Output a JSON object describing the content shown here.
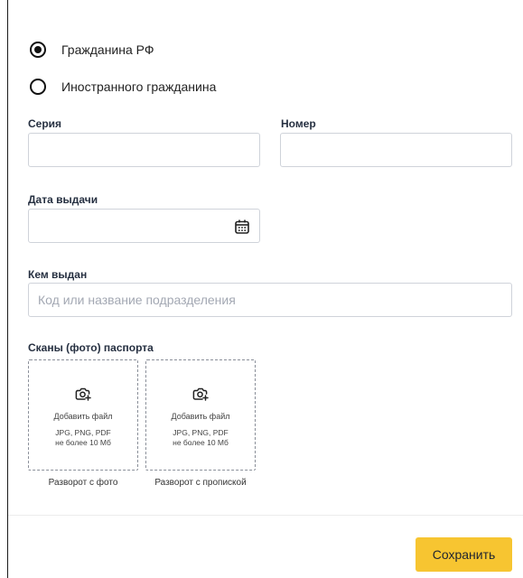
{
  "citizenship": {
    "options": [
      {
        "label": "Гражданина РФ",
        "selected": true
      },
      {
        "label": "Иностранного гражданина",
        "selected": false
      }
    ]
  },
  "fields": {
    "series_label": "Серия",
    "series_value": "",
    "number_label": "Номер",
    "number_value": "",
    "issue_date_label": "Дата выдачи",
    "issue_date_value": "",
    "issued_by_label": "Кем выдан",
    "issued_by_placeholder": "Код или название подразделения"
  },
  "scans": {
    "title": "Сканы (фото) паспорта",
    "slots": [
      {
        "add_label": "Добавить файл",
        "formats": "JPG, PNG, PDF",
        "limit": "не более 10 Мб",
        "caption": "Разворот с фото"
      },
      {
        "add_label": "Добавить файл",
        "formats": "JPG, PNG, PDF",
        "limit": "не более 10 Мб",
        "caption": "Разворот с пропиской"
      }
    ]
  },
  "actions": {
    "save_label": "Сохранить"
  },
  "icons": {
    "calendar": "calendar-icon",
    "camera": "camera-add-icon"
  },
  "colors": {
    "accent": "#f7c531",
    "border": "#cfd3da"
  }
}
